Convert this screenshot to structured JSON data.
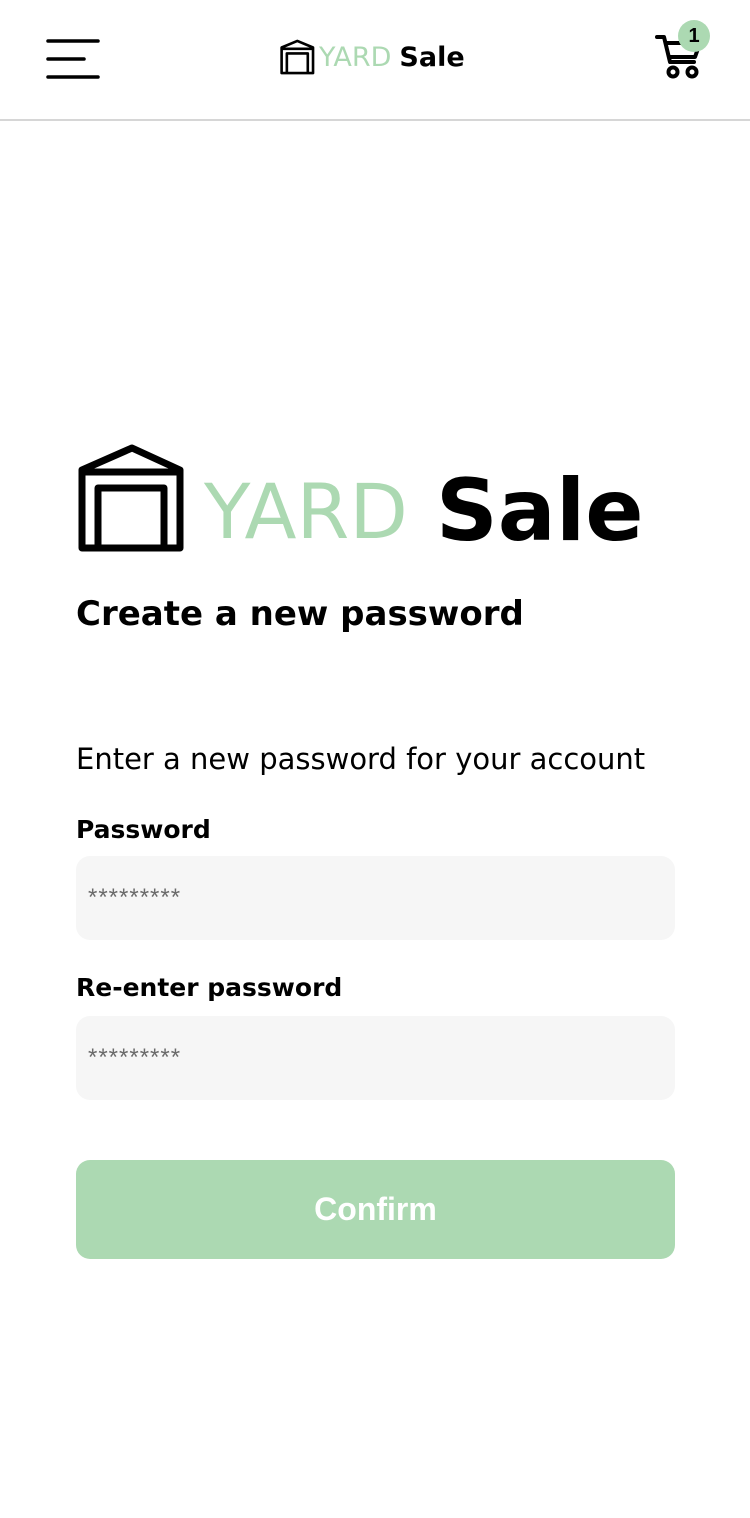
{
  "header": {
    "logo": {
      "yard": "YARD",
      "sale": "Sale"
    },
    "cart": {
      "badge_count": "1"
    }
  },
  "main": {
    "logo": {
      "yard": "YARD",
      "sale": "Sale"
    },
    "title": "Create a new password",
    "subtitle": "Enter a new password for your account",
    "password": {
      "label": "Password",
      "placeholder": "*********"
    },
    "reenter_password": {
      "label": "Re-enter password",
      "placeholder": "*********"
    },
    "confirm_label": "Confirm"
  },
  "colors": {
    "accent": "#acd9b2",
    "input_background": "#f6f6f6",
    "divider": "#d6d6d6"
  },
  "icons": [
    "menu-icon",
    "logo-house-icon",
    "cart-icon"
  ]
}
